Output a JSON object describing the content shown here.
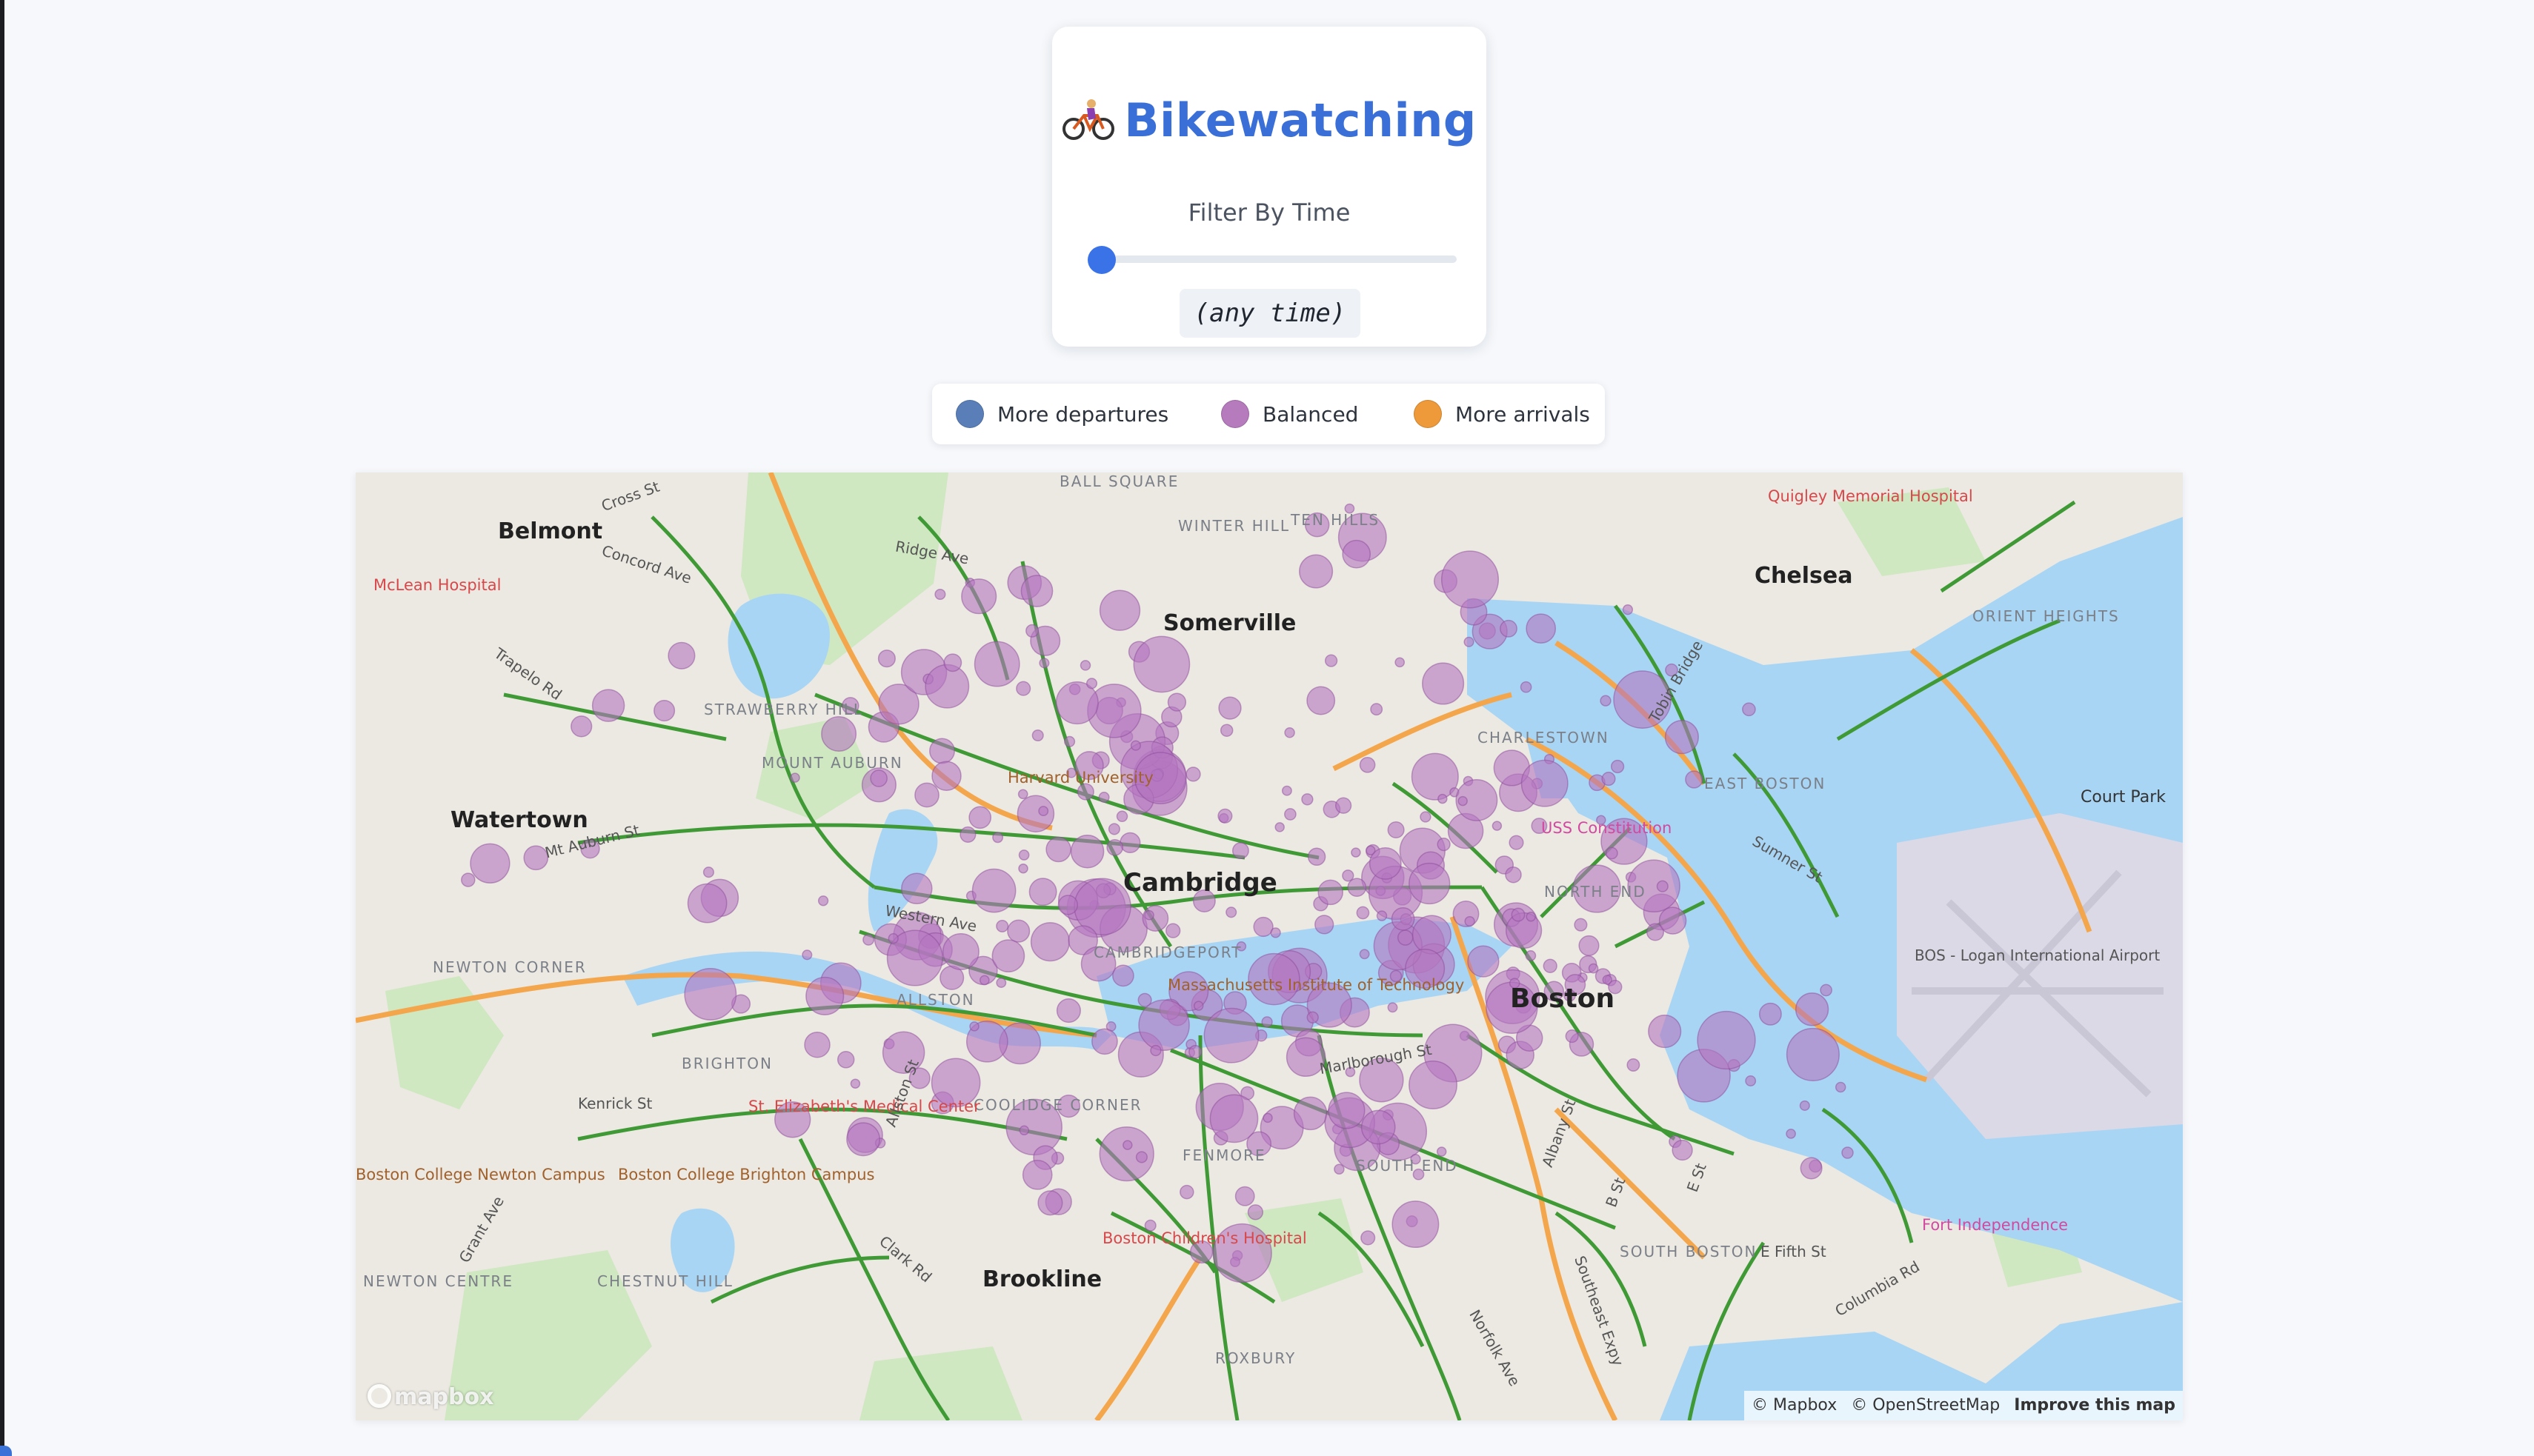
{
  "app": {
    "title": "Bikewatching"
  },
  "filter": {
    "label": "Filter By Time",
    "time_text": "(any time)",
    "slider_value": 0,
    "slider_min": 0,
    "slider_max": 1440
  },
  "legend": {
    "items": [
      {
        "label": "More departures",
        "color": "#5a7fb8"
      },
      {
        "label": "Balanced",
        "color": "#b57bbd"
      },
      {
        "label": "More arrivals",
        "color": "#ee9a3a"
      }
    ]
  },
  "map": {
    "colors": {
      "land": "#ece9e2",
      "water": "#a9d5f5",
      "park": "#cfe8c1",
      "bike_lane": "#3f9a36",
      "highway": "#f3a64c",
      "station_fill": "#b477c0",
      "station_stroke": "#8c4a9a"
    },
    "cities": [
      "Belmont",
      "Somerville",
      "Chelsea",
      "Watertown",
      "Cambridge",
      "Boston",
      "Brookline"
    ],
    "neighborhoods": [
      "WINTER HILL",
      "TEN HILLS",
      "BALL SQUARE",
      "CHARLESTOWN",
      "EAST BOSTON",
      "NORTH END",
      "ALLSTON",
      "BRIGHTON",
      "NEWTON CORNER",
      "SOUTH BOSTON",
      "SOUTH END",
      "ROXBURY",
      "NEWTON CENTRE",
      "CHESTNUT HILL",
      "COOLIDGE CORNER",
      "ORIENT HEIGHTS",
      "CAMBRIDGEPORT",
      "FENMORE",
      "STRAWBERRY HILL",
      "MOUNT AUBURN"
    ],
    "pois": [
      {
        "label": "McLean Hospital",
        "kind": "red"
      },
      {
        "label": "Quigley Memorial Hospital",
        "kind": "red"
      },
      {
        "label": "St. Elizabeth's Medical Center",
        "kind": "red"
      },
      {
        "label": "Boston Children's Hospital",
        "kind": "red"
      },
      {
        "label": "Massachusetts Institute of Technology",
        "kind": "brown"
      },
      {
        "label": "Boston College Brighton Campus",
        "kind": "brown"
      },
      {
        "label": "Boston College Newton Campus",
        "kind": "brown"
      },
      {
        "label": "Harvard University",
        "kind": "brown"
      },
      {
        "label": "Fort Independence",
        "kind": "pink"
      },
      {
        "label": "USS Constitution",
        "kind": "pink"
      },
      {
        "label": "BOS - Logan International Airport",
        "kind": "grey"
      },
      {
        "label": "Court Park",
        "kind": "grey"
      }
    ],
    "streets": [
      "Cross St",
      "Concord Ave",
      "Ridge Ave",
      "Trapelo Rd",
      "Mt Auburn St",
      "Western Ave",
      "Kenrick St",
      "Allston St",
      "Grant Ave",
      "Clark Rd",
      "Marlborough St",
      "Albany St",
      "E Fifth St",
      "Columbia Rd",
      "Norfolk Ave",
      "Southeast Expy",
      "Tobin Bridge",
      "Sumner St",
      "E St",
      "B St"
    ],
    "logo": "mapbox",
    "attribution": {
      "mapbox": "© Mapbox",
      "osm": "© OpenStreetMap",
      "improve": "Improve this map"
    }
  }
}
